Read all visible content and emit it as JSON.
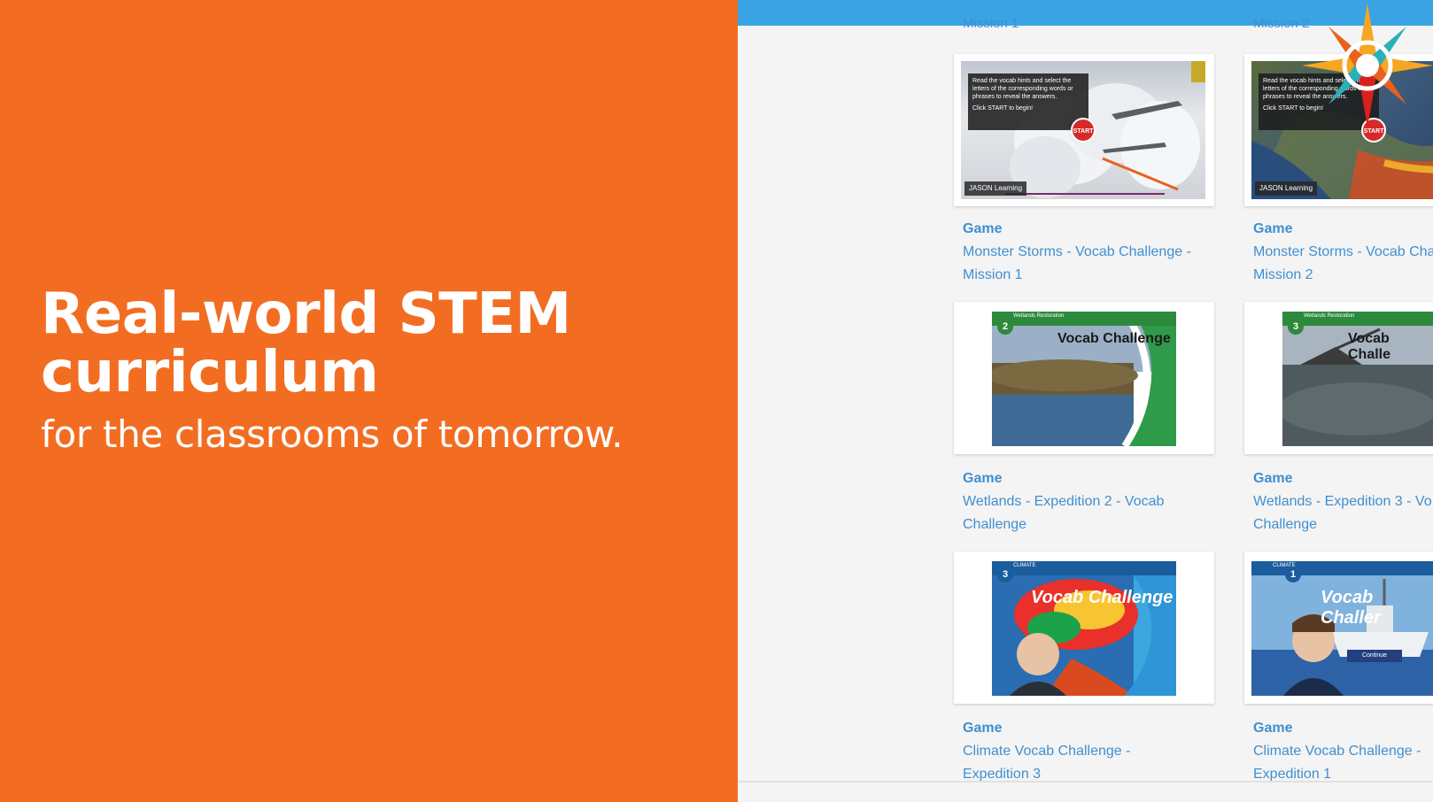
{
  "promo": {
    "headline_line1": "Real-world STEM",
    "headline_line2": "curriculum",
    "subheadline": "for the classrooms of tomorrow."
  },
  "colors": {
    "promo_bg": "#f26d22",
    "top_bar": "#3aa3e3",
    "link": "#3f8fd1",
    "panel_bg": "#f4f4f4"
  },
  "cutoff_labels": [
    "Mission 1",
    "Mission 2"
  ],
  "cards": [
    {
      "type": "Game",
      "title": "Monster Storms - Vocab Challenge -\nMission 1",
      "thumb": {
        "instructions": "Read the vocab hints and select the letters of the corresponding words or phrases to reveal the answers.",
        "hint": "Click START to begin!",
        "button": "START",
        "logo": "JASON Learning"
      }
    },
    {
      "type": "Game",
      "title": "Monster Storms - Vocab Cha\nMission 2",
      "thumb": {
        "instructions": "Read the vocab hints and select the letters of the corresponding words or phrases to reveal the answers.",
        "hint": "Click START to begin!",
        "button": "START",
        "logo": "JASON Learning"
      }
    },
    {
      "type": "Game",
      "title": "Wetlands - Expedition 2 - Vocab\nChallenge",
      "thumb": {
        "number": "2",
        "banner": "Wetlands Restoration",
        "heading": "Vocab Challenge"
      }
    },
    {
      "type": "Game",
      "title": "Wetlands - Expedition 3 - Vo\nChallenge",
      "thumb": {
        "number": "3",
        "banner": "Wetlands Restoration",
        "heading": "Vocab Challe"
      }
    },
    {
      "type": "Game",
      "title": "Climate Vocab Challenge -\nExpedition 3",
      "thumb": {
        "number": "3",
        "banner": "CLIMATE",
        "heading": "Vocab Challenge"
      }
    },
    {
      "type": "Game",
      "title": "Climate Vocab Challenge -\nExpedition 1",
      "thumb": {
        "number": "1",
        "banner": "CLIMATE",
        "heading": "Vocab Challer",
        "button": "Continue"
      }
    }
  ],
  "icons": {
    "compass": "compass-star-logo-icon"
  }
}
